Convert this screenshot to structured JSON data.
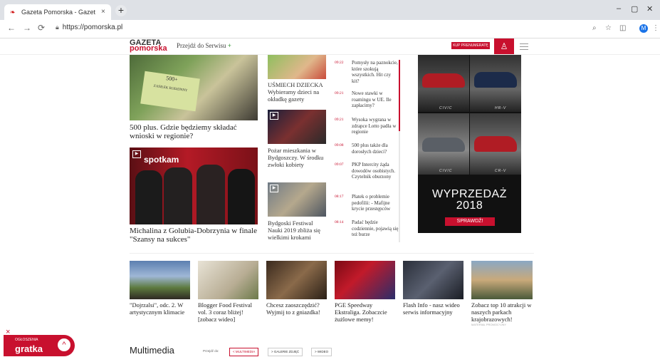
{
  "browser": {
    "tab_title": "Gazeta Pomorska - Gazeta Pomo",
    "tab_close": "×",
    "new_tab": "+",
    "url": "https://pomorska.pl",
    "avatar_letter": "M",
    "min": "–",
    "max": "▢",
    "close": "✕"
  },
  "header": {
    "logo_line1": "GAZETA",
    "logo_line2": "pomorska",
    "przejdz": "Przejdź do Serwisu",
    "przejdz_plus": "+",
    "kup": "KUP PRENUMERATĘ"
  },
  "featured": [
    {
      "caption": "500 plus. Gdzie będziemy składać wnioski w regionie?",
      "img_text_1": "500+",
      "img_text_2": "ZASIŁEK RODZINNY"
    },
    {
      "caption": "Michalina z Golubia-Dobrzynia w finale \"Szansy na sukces\"",
      "img_text": "spotkam"
    }
  ],
  "middle": [
    {
      "caption": "UŚMIECH DZIECKA Wybieramy dzieci na okładkę gazety"
    },
    {
      "caption": "Pożar mieszkania w Bydgoszczy. W środku zwłoki kobiety"
    },
    {
      "caption": "Bydgoski Festiwal Nauki 2019 zbliża się wielkimi krokami"
    }
  ],
  "news": [
    {
      "time": "09:22",
      "title": "Pomysły na paznokcie, które szokują wszystkich. Hit czy kit?"
    },
    {
      "time": "09:21",
      "title": "Nowe stawki w roamingu w UE. Ile zapłacimy?"
    },
    {
      "time": "09:21",
      "title": "Wysoka wygrana w zdrapce Lotto padła w regionie"
    },
    {
      "time": "09:08",
      "title": "500 plus także dla dorosłych dzieci?"
    },
    {
      "time": "09:07",
      "title": "PKP Intercity żąda dowodów osobistych. Czytelnik oburzony"
    },
    {
      "time": "08:17",
      "title": "Płatek o problemie pedofilii: - Mafijne krycie przestępców"
    },
    {
      "time": "08:14",
      "title": "Padać będzie codziennie, pojawią się też burze"
    }
  ],
  "ad": {
    "model_1": "CIVIC",
    "model_2": "HR-V",
    "model_3": "CIVIC",
    "model_4": "CR-V",
    "headline_1": "WYPRZEDAŻ",
    "headline_2": "2018",
    "cta": "SPRAWDŹ!"
  },
  "bottom_row": [
    {
      "caption": "\"Dojrzalsi\", odc. 2. W artystycznym klimacie",
      "source": ""
    },
    {
      "caption": "Blogger Food Festival vol. 3 coraz bliżej! [zobacz wideo]",
      "source": ""
    },
    {
      "caption": "Chcesz zaoszczędzić? Wyjmij to z gniazdka!",
      "source": ""
    },
    {
      "caption": "PGE Speedway Ekstraliga. Zobaczcie żużlowe memy!",
      "source": ""
    },
    {
      "caption": "Flash Info - nasz wideo serwis informacyjny",
      "source": ""
    },
    {
      "caption": "Zobacz top 10 atrakcji w naszych parkach krajobrazowych!",
      "source": "MATERIAŁ PROMOCYJNY"
    }
  ],
  "multimedia": {
    "title": "Multimedia",
    "label": "Przejdź do:",
    "tab_1": "< MULTIMEDIA",
    "tab_2": "> GALERIE ZDJĘĆ",
    "tab_3": "> WIDEO"
  },
  "ogloszenia": {
    "label": "OGŁOSZENIA",
    "brand": "gratka",
    "close": "×",
    "up": "^"
  }
}
